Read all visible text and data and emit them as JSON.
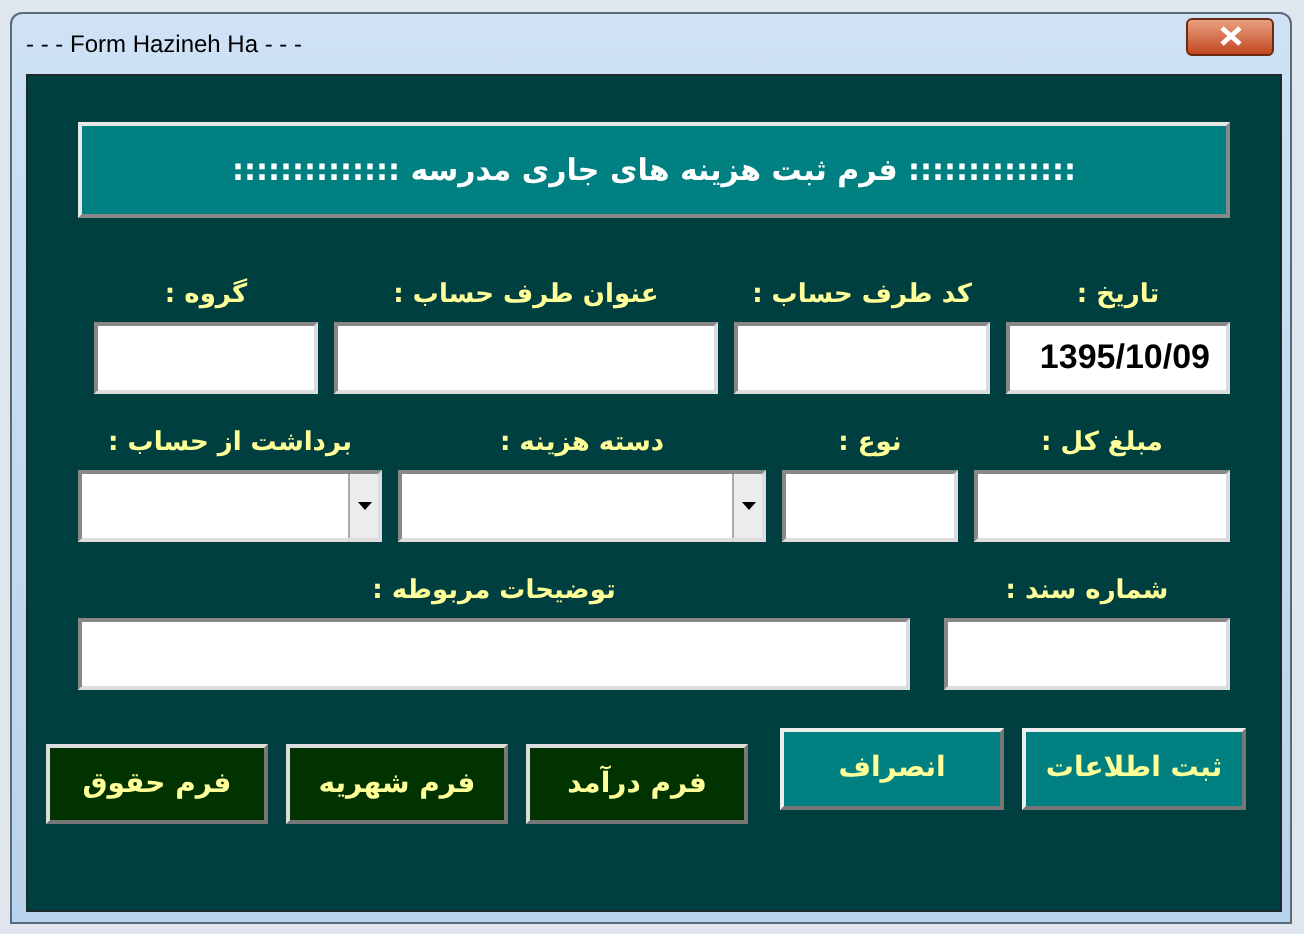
{
  "window": {
    "title": "- - - Form Hazineh Ha - - -"
  },
  "header": {
    "text": ":::::::::::::: فرم ثبت هزینه های جاری مدرسه ::::::::::::::"
  },
  "rows": [
    [
      {
        "label": "تاریخ :",
        "value": "1395/10/09",
        "kind": "text"
      },
      {
        "label": "کد طرف حساب :",
        "kind": "text"
      },
      {
        "label": "عنوان طرف حساب :",
        "kind": "text"
      },
      {
        "label": "گروه :",
        "kind": "text"
      }
    ],
    [
      {
        "label": "مبلغ کل :",
        "kind": "text"
      },
      {
        "label": "نوع :",
        "kind": "text"
      },
      {
        "label": "دسته هزینه :",
        "kind": "dropdown"
      },
      {
        "label": "برداشت از حساب :",
        "kind": "dropdown"
      }
    ],
    [
      {
        "label": "شماره سند :",
        "kind": "text"
      },
      {
        "label": "توضیحات مربوطه :",
        "kind": "text"
      }
    ]
  ],
  "buttons": [
    {
      "label": "ثبت اطلاعات",
      "kind": "action"
    },
    {
      "label": "انصراف",
      "kind": "action"
    },
    {
      "label": "فرم درآمد",
      "kind": "nav"
    },
    {
      "label": "فرم شهریه",
      "kind": "nav"
    },
    {
      "label": "فرم حقوق",
      "kind": "nav"
    }
  ]
}
